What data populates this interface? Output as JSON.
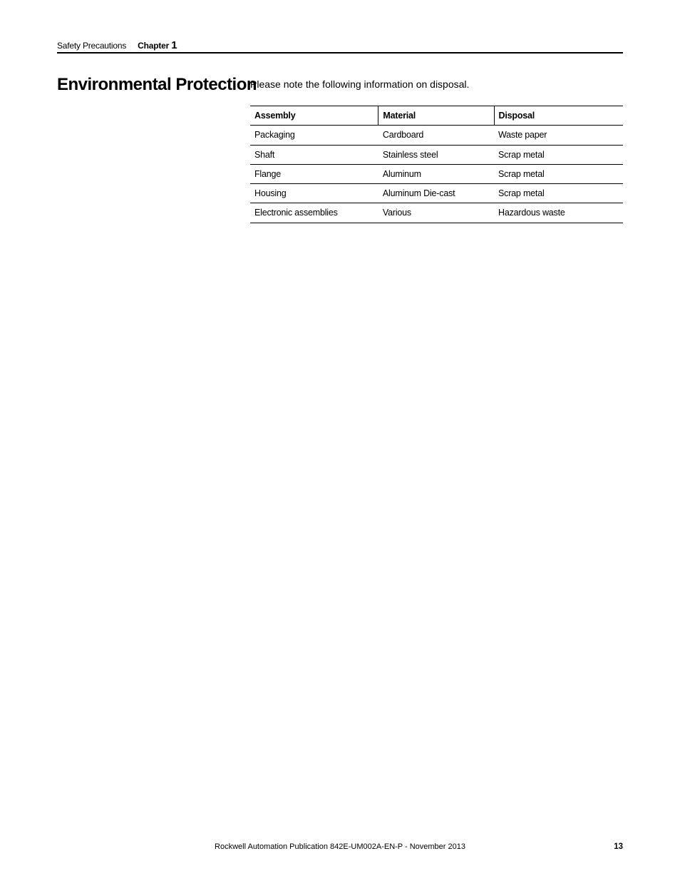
{
  "header": {
    "section": "Safety Precautions",
    "chapter_label": "Chapter",
    "chapter_number": "1"
  },
  "section_title": "Environmental Protection",
  "body_text": "Please note the following information on disposal.",
  "table": {
    "headers": {
      "assembly": "Assembly",
      "material": "Material",
      "disposal": "Disposal"
    },
    "rows": [
      {
        "assembly": "Packaging",
        "material": "Cardboard",
        "disposal": "Waste paper"
      },
      {
        "assembly": "Shaft",
        "material": "Stainless steel",
        "disposal": "Scrap metal"
      },
      {
        "assembly": "Flange",
        "material": "Aluminum",
        "disposal": "Scrap metal"
      },
      {
        "assembly": "Housing",
        "material": "Aluminum Die-cast",
        "disposal": "Scrap metal"
      },
      {
        "assembly": "Electronic assemblies",
        "material": "Various",
        "disposal": "Hazardous waste"
      }
    ]
  },
  "footer": {
    "publication": "Rockwell Automation Publication 842E-UM002A-EN-P - November 2013",
    "page": "13"
  }
}
